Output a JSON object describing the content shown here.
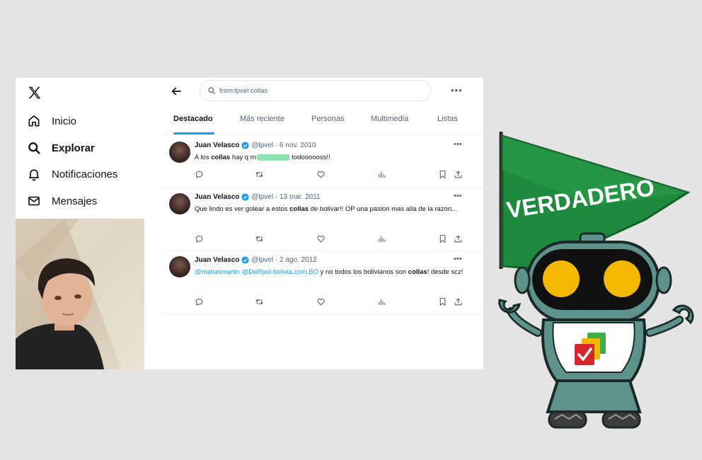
{
  "nav": {
    "items": [
      {
        "label": "Inicio",
        "icon": "home-icon"
      },
      {
        "label": "Explorar",
        "icon": "search-icon"
      },
      {
        "label": "Notificaciones",
        "icon": "bell-icon"
      },
      {
        "label": "Mensajes",
        "icon": "mail-icon"
      }
    ]
  },
  "search": {
    "value": "from:lpvel collas"
  },
  "tabs": [
    "Destacado",
    "Más reciente",
    "Personas",
    "Multimedia",
    "Listas"
  ],
  "tweets": [
    {
      "name": "Juan Velasco",
      "handle": "@lpvel",
      "date": "6 nov. 2010",
      "pre": "A los ",
      "bold": "collas",
      "mid": " hay q m",
      "post": " todoooooss!!"
    },
    {
      "name": "Juan Velasco",
      "handle": "@lpvel",
      "date": "13 mar. 2011",
      "pre": "Que lindo es ver golear a estos ",
      "bold": "collas",
      "post": " de bolivar!! OP una pasion mas alla de la razon..."
    },
    {
      "name": "Juan Velasco",
      "handle": "@lpvel",
      "date": "2 ago. 2012",
      "mention": "@matiasmartin @DeRpol·bolivia.com.BO",
      "pre": " y no todos los bolivianos son ",
      "bold": "collas",
      "post": "! desde scz!"
    }
  ],
  "flag": {
    "label": "VERDADERO"
  },
  "colors": {
    "accent": "#1d9bf0",
    "flag_green": "#1f8a3d",
    "robot_teal": "#5e938b",
    "robot_eye": "#f5b800"
  }
}
